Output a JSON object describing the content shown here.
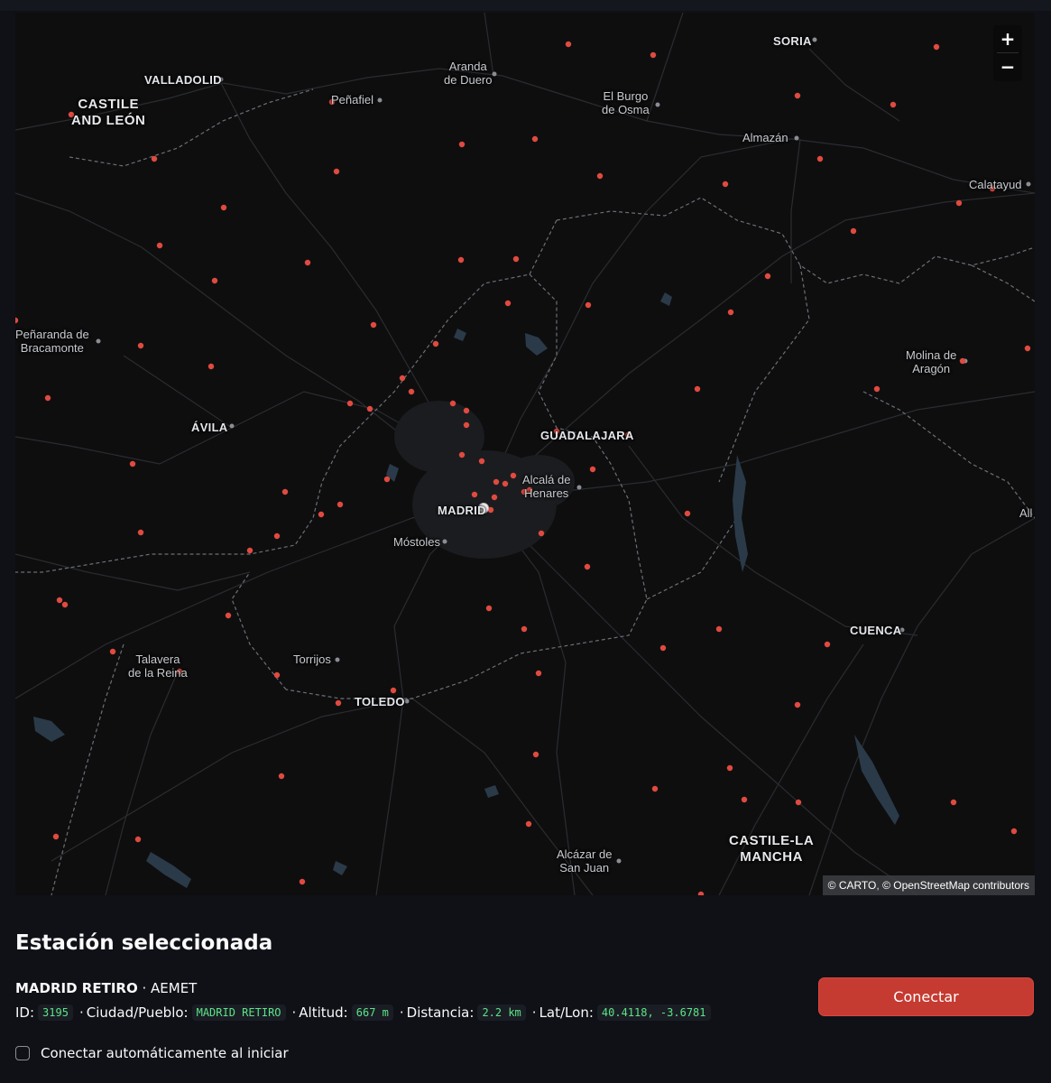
{
  "map": {
    "zoom_in_label": "+",
    "zoom_out_label": "−",
    "attribution": {
      "carto": "© CARTO",
      "osm": "© OpenStreetMap",
      "contributors": "contributors"
    },
    "marker_color": "#e04a3f",
    "selected_marker_color": "#ffffff",
    "places": {
      "soria": "SORIA",
      "valladolid": "VALLADOLID",
      "aranda_1": "Aranda",
      "aranda_2": "de Duero",
      "castile_leon_1": "CASTILE",
      "castile_leon_2": "AND LEÓN",
      "penafiel": "Peñafiel",
      "burgo_1": "El Burgo",
      "burgo_2": "de Osma",
      "almazan": "Almazán",
      "calatayud": "Calatayud",
      "penaranda_1": "Peñaranda de",
      "penaranda_2": "Bracamonte",
      "molina_1": "Molina de",
      "molina_2": "Aragón",
      "avila": "ÁVILA",
      "guadalajara": "GUADALAJARA",
      "alcala_1": "Alcalá de",
      "alcala_2": "Henares",
      "madrid": "MADRID",
      "mostoles": "Móstoles",
      "all": "All",
      "cuenca": "CUENCA",
      "talavera_1": "Talavera",
      "talavera_2": "de la Reina",
      "torrijos": "Torrijos",
      "toledo": "TOLEDO",
      "castile_mancha_1": "CASTILE-LA",
      "castile_mancha_2": "MANCHA",
      "alcazar_1": "Alcázar de",
      "alcazar_2": "San Juan"
    }
  },
  "station": {
    "section_title": "Estación seleccionada",
    "name": "MADRID RETIRO",
    "provider": "AEMET",
    "id_label": "ID:",
    "id": "3195",
    "city_label": "Ciudad/Pueblo:",
    "city": "MADRID RETIRO",
    "altitude_label": "Altitud:",
    "altitude": "667 m",
    "distance_label": "Distancia:",
    "distance": "2.2 km",
    "latlon_label": "Lat/Lon:",
    "latlon": "40.4118, -3.6781",
    "connect_button": "Conectar",
    "auto_connect_label": "Conectar automáticamente al iniciar",
    "auto_connect_checked": false,
    "accent_color": "#c53a31"
  }
}
